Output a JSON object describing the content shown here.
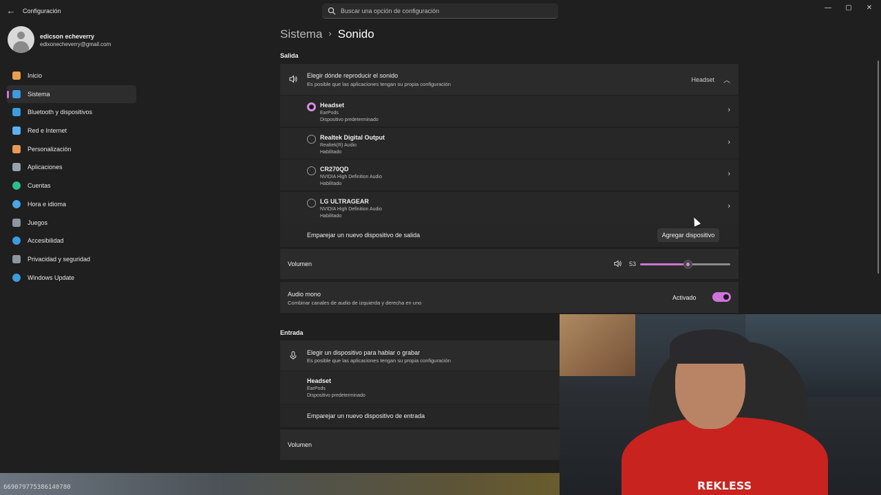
{
  "window": {
    "title": "Configuración",
    "search_placeholder": "Buscar una opción de configuración",
    "controls": [
      "—",
      "▢",
      "✕"
    ]
  },
  "profile": {
    "name": "edicson echeverry",
    "email": "edixonecheverry@gmail.com"
  },
  "sidebar": {
    "items": [
      {
        "label": "Inicio",
        "icon": "home-icon",
        "color": "#e8a050"
      },
      {
        "label": "Sistema",
        "icon": "monitor-icon",
        "color": "#3b9de0",
        "active": true
      },
      {
        "label": "Bluetooth y dispositivos",
        "icon": "bluetooth-icon",
        "color": "#3b9de0"
      },
      {
        "label": "Red e Internet",
        "icon": "wifi-icon",
        "color": "#5ab3f0"
      },
      {
        "label": "Personalización",
        "icon": "brush-icon",
        "color": "#e89a54"
      },
      {
        "label": "Aplicaciones",
        "icon": "apps-icon",
        "color": "#9aa0a8"
      },
      {
        "label": "Cuentas",
        "icon": "person-icon",
        "color": "#2fbf8f"
      },
      {
        "label": "Hora e idioma",
        "icon": "globe-clock-icon",
        "color": "#4aa6e6"
      },
      {
        "label": "Juegos",
        "icon": "gamepad-icon",
        "color": "#8f96a0"
      },
      {
        "label": "Accesibilidad",
        "icon": "accessibility-icon",
        "color": "#3b9de0"
      },
      {
        "label": "Privacidad y seguridad",
        "icon": "shield-icon",
        "color": "#8f96a0"
      },
      {
        "label": "Windows Update",
        "icon": "update-icon",
        "color": "#3b9de0"
      }
    ]
  },
  "breadcrumb": {
    "parent": "Sistema",
    "separator": "›",
    "current": "Sonido"
  },
  "output": {
    "section_title": "Salida",
    "header": {
      "title": "Elegir dónde reproducir el sonido",
      "subtitle": "Es posible que las aplicaciones tengan su propia configuración",
      "selected": "Headset"
    },
    "devices": [
      {
        "name": "Headset",
        "line2": "EarPods",
        "line3": "Dispositivo predeterminado",
        "selected": true
      },
      {
        "name": "Realtek Digital Output",
        "line2": "Realtek(R) Audio",
        "line3": "Habilitado",
        "selected": false
      },
      {
        "name": "CR270QD",
        "line2": "NVIDIA High Definition Audio",
        "line3": "Habilitado",
        "selected": false
      },
      {
        "name": "LG ULTRAGEAR",
        "line2": "NVIDIA High Definition Audio",
        "line3": "Habilitado",
        "selected": false
      }
    ],
    "pair_label": "Emparejar un nuevo dispositivo de salida",
    "add_button": "Agregar dispositivo",
    "volume_label": "Volumen",
    "volume_value": "53",
    "volume_fraction": 0.53,
    "mono_title": "Audio mono",
    "mono_subtitle": "Combinar canales de audio de izquierda y derecha en uno",
    "mono_state": "Activado"
  },
  "input": {
    "section_title": "Entrada",
    "header": {
      "title": "Elegir un dispositivo para hablar o grabar",
      "subtitle": "Es posible que las aplicaciones tengan su propia configuración"
    },
    "device": {
      "name": "Headset",
      "line2": "EarPods",
      "line3": "Dispositivo predeterminado"
    },
    "pair_label": "Emparejar un nuevo dispositivo de entrada",
    "volume_label": "Volumen"
  },
  "overlay": {
    "id_text": "669079775386140780",
    "webcam_logo": "REKLESS"
  },
  "colors": {
    "accent": "#cf73d9",
    "background": "#1f1f1f",
    "card": "#2b2b2b"
  }
}
